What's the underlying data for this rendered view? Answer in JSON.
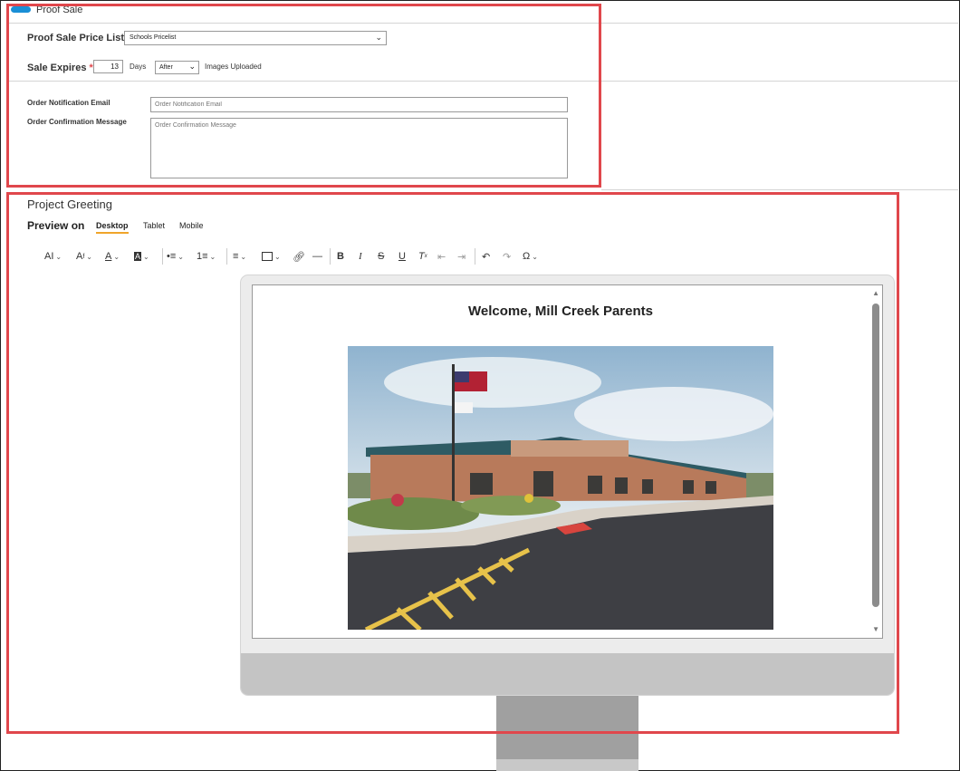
{
  "proof_sale": {
    "toggle_label": "Proof Sale",
    "price_list_label": "Proof Sale Price List",
    "price_list_value": "Schools Pricelist",
    "sale_expires_label": "Sale Expires",
    "required_marker": "*",
    "sale_expires_value": "13",
    "days_label": "Days",
    "timing_value": "After",
    "images_uploaded_label": "Images Uploaded",
    "order_email_label": "Order Notification Email",
    "order_email_placeholder": "Order Notification Email",
    "order_confirm_label": "Order Confirmation Message",
    "order_confirm_placeholder": "Order Confirmation Message"
  },
  "greeting": {
    "title": "Project Greeting",
    "preview_label": "Preview on",
    "tabs": [
      "Desktop",
      "Tablet",
      "Mobile"
    ],
    "active_tab": "Desktop",
    "welcome_text": "Welcome, Mill Creek Parents"
  },
  "toolbar": [
    "font-size-icon",
    "text-style-icon",
    "font-color-icon",
    "highlight-icon",
    "bulleted-list-icon",
    "numbered-list-icon",
    "align-icon",
    "image-icon",
    "link-icon",
    "horizontal-rule-icon",
    "bold-icon",
    "italic-icon",
    "strikethrough-icon",
    "underline-icon",
    "clear-format-icon",
    "outdent-icon",
    "indent-icon",
    "undo-icon",
    "redo-icon",
    "special-char-icon"
  ],
  "colors": {
    "highlight": "#e0474c",
    "toggle": "#1a8fd6",
    "active_tab_underline": "#f0a52a"
  }
}
